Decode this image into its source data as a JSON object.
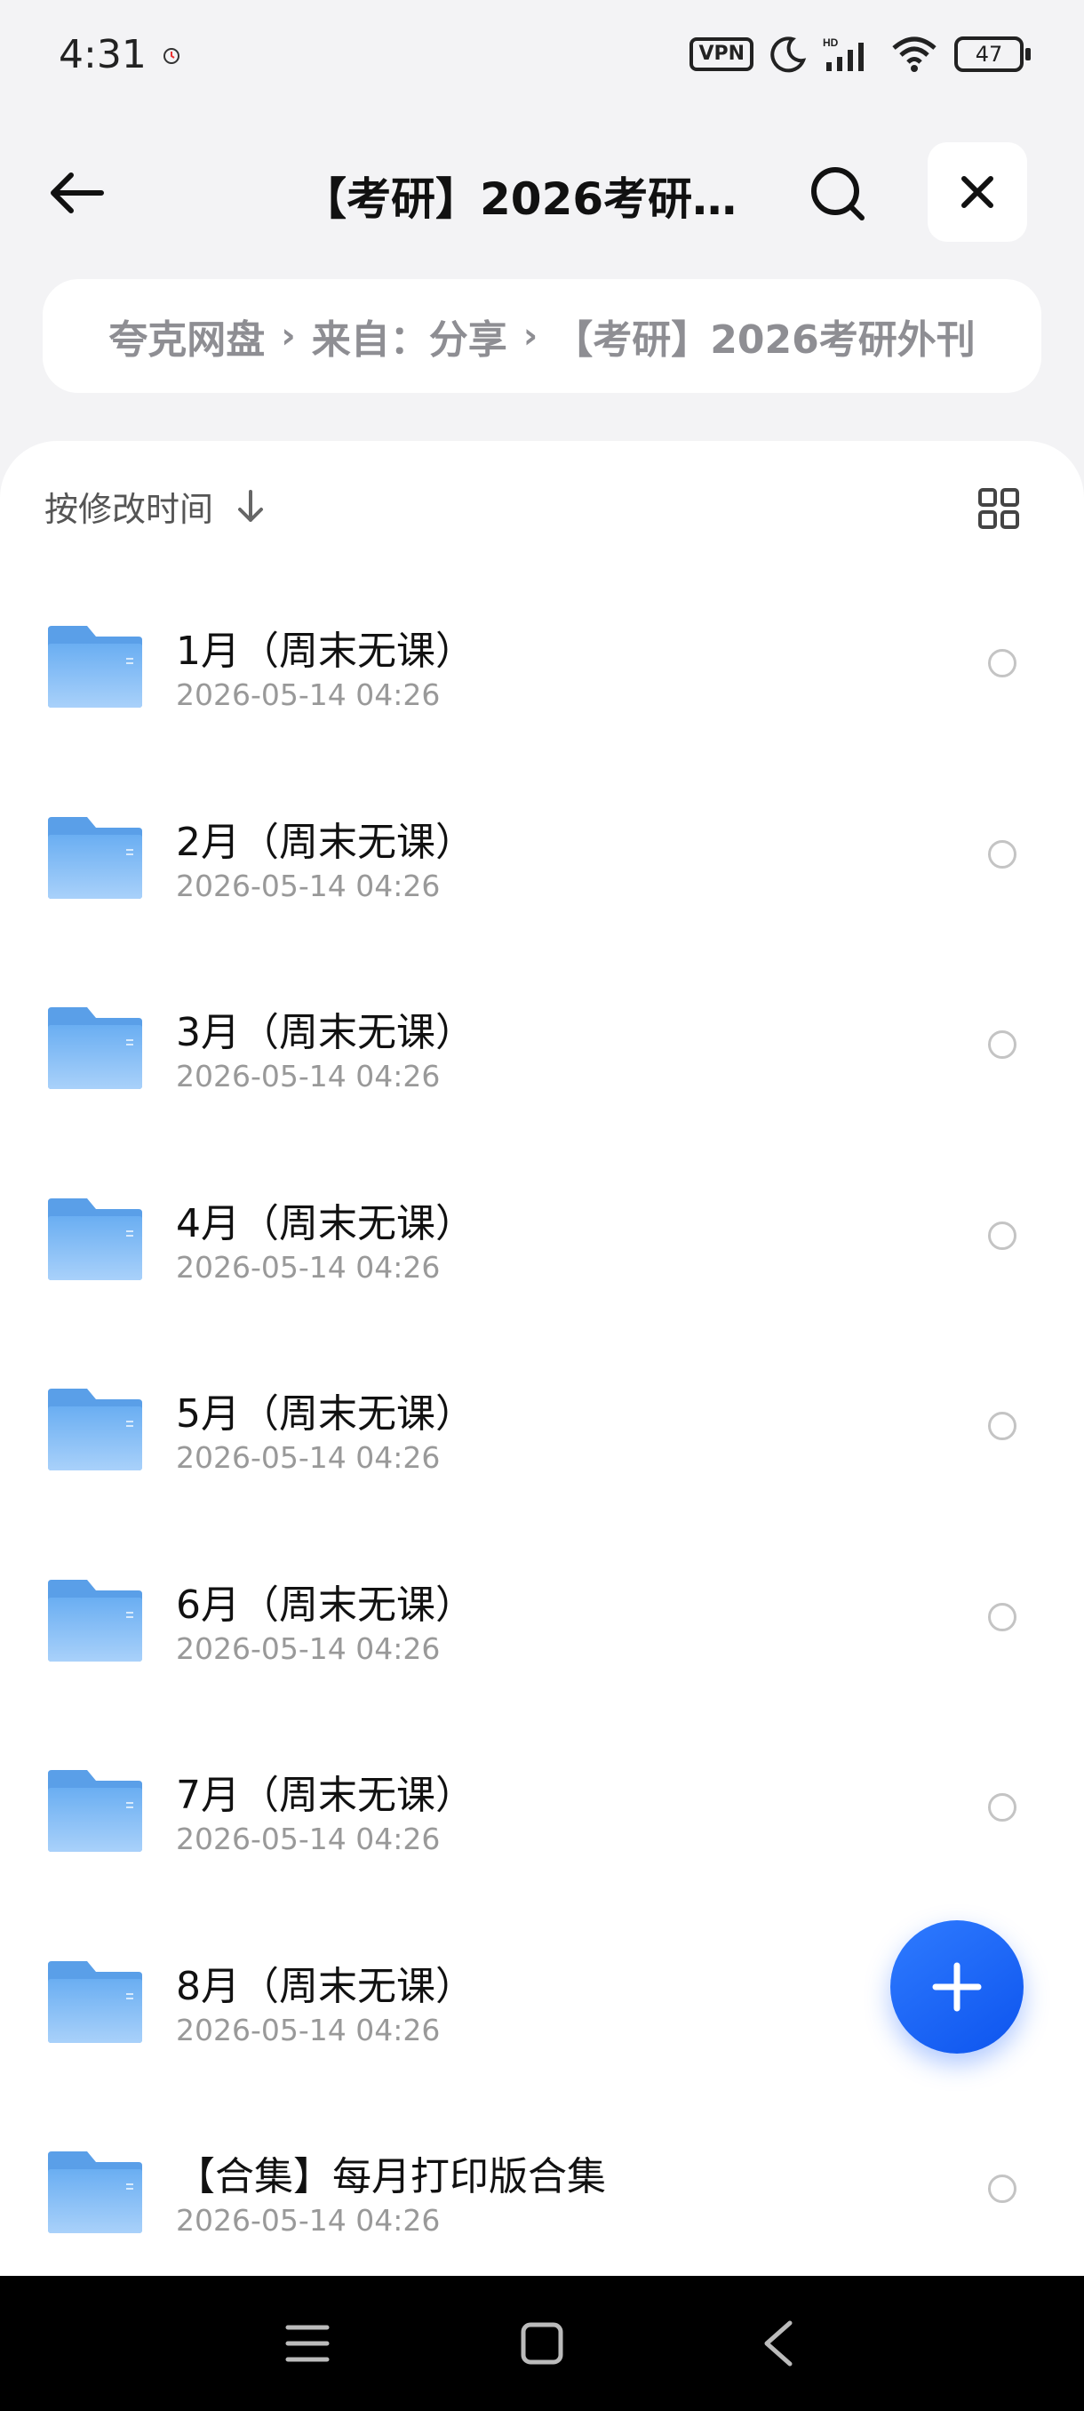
{
  "status_bar": {
    "time": "4:31",
    "vpn": "VPN",
    "battery": "47",
    "icons": [
      "clock-icon",
      "vpn-badge",
      "moon-icon",
      "signal-icon",
      "wifi-icon",
      "battery-icon"
    ]
  },
  "header": {
    "title": "【考研】2026考研…",
    "back_icon": "arrow-left-icon",
    "search_icon": "search-icon",
    "close_icon": "close-icon"
  },
  "breadcrumb": {
    "items": [
      "夸克网盘",
      "来自：分享",
      "【考研】2026考研外刊"
    ],
    "separator": "›"
  },
  "sort": {
    "label": "按修改时间",
    "direction_icon": "arrow-down-icon",
    "view_icon": "grid-view-icon"
  },
  "files": [
    {
      "name": "1月（周末无课）",
      "date": "2026-05-14 04:26"
    },
    {
      "name": "2月（周末无课）",
      "date": "2026-05-14 04:26"
    },
    {
      "name": "3月（周末无课）",
      "date": "2026-05-14 04:26"
    },
    {
      "name": "4月（周末无课）",
      "date": "2026-05-14 04:26"
    },
    {
      "name": "5月（周末无课）",
      "date": "2026-05-14 04:26"
    },
    {
      "name": "6月（周末无课）",
      "date": "2026-05-14 04:26"
    },
    {
      "name": "7月（周末无课）",
      "date": "2026-05-14 04:26"
    },
    {
      "name": "8月（周末无课）",
      "date": "2026-05-14 04:26"
    },
    {
      "name": "【合集】每月打印版合集",
      "date": "2026-05-14 04:26"
    }
  ],
  "fab": {
    "icon": "plus-icon"
  },
  "colors": {
    "accent": "#1a62f5",
    "folder": "#7fb8f2",
    "background": "#f3f3f5"
  },
  "nav_bar": {
    "icons": [
      "menu-icon",
      "home-icon",
      "back-icon"
    ]
  }
}
